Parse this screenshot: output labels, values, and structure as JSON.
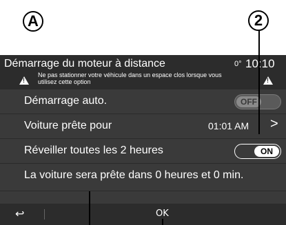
{
  "callouts": {
    "a": "A",
    "two": "2"
  },
  "header": {
    "title": "Démarrage du moteur à distance",
    "temperature": "0°",
    "clock": "10:10",
    "warning": "Ne pas stationner votre véhicule dans un espace clos lorsque vous utilisez cette option",
    "warning_icon": "warning-triangle-icon"
  },
  "rows": {
    "auto_start": {
      "label": "Démarrage auto.",
      "toggle": "OFF"
    },
    "ready_for": {
      "label": "Voiture prête pour",
      "value": "01:01 AM",
      "chevron": ">"
    },
    "wake": {
      "label": "Réveiller toutes les 2 heures",
      "toggle": "ON"
    },
    "info": {
      "label": "La voiture sera prête dans 0 heures et 0 min."
    }
  },
  "footer": {
    "back_icon": "↩",
    "ok_label": "OK"
  },
  "colors": {
    "screen_bg": "#3a3a3a",
    "header_bg": "#2c2c2c",
    "text": "#ffffff"
  }
}
